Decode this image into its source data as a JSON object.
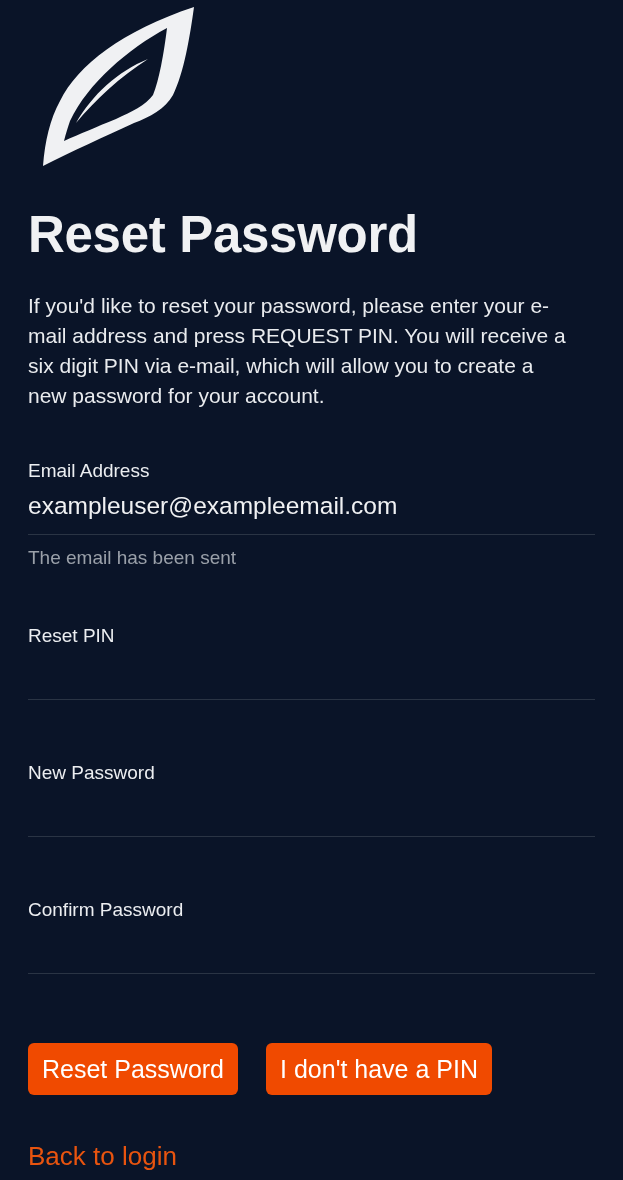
{
  "title": "Reset Password",
  "description": "If you'd like to reset your password, please enter your e-mail address and press REQUEST PIN. You will receive a six digit PIN via e-mail, which will allow you to create a new password for your account.",
  "fields": [
    {
      "label": "Email Address",
      "value": "exampleuser@exampleemail.com",
      "helper": "The email has been sent"
    },
    {
      "label": "Reset PIN"
    },
    {
      "label": "New Password"
    },
    {
      "label": "Confirm Password"
    }
  ],
  "buttons": [
    "Reset Password",
    "I don't have a PIN"
  ],
  "link": "Back to login"
}
